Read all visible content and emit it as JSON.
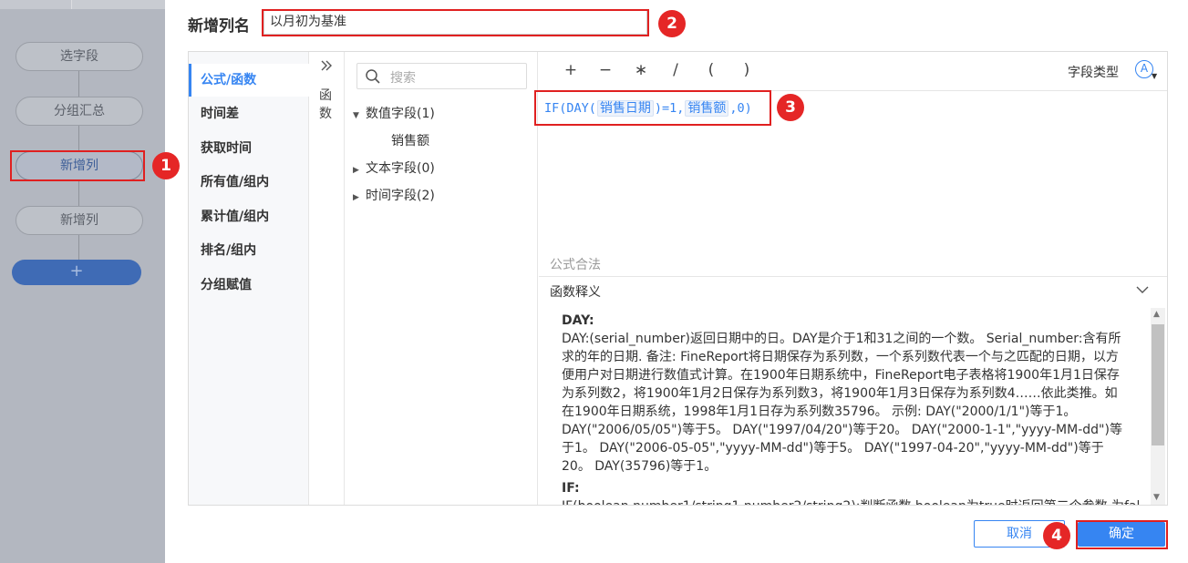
{
  "flow": {
    "nodes": [
      "选字段",
      "分组汇总",
      "新增列",
      "新增列"
    ],
    "add_label": "+"
  },
  "dialog": {
    "title_label": "新增列名",
    "column_name_value": "以月初为基准",
    "categories": [
      "公式/函数",
      "时间差",
      "获取时间",
      "所有值/组内",
      "累计值/组内",
      "排名/组内",
      "分组赋值"
    ],
    "collapse_label": "函数",
    "search_placeholder": "搜索",
    "tree": {
      "numeric_group": "数值字段(1)",
      "numeric_child": "销售额",
      "text_group": "文本字段(0)",
      "time_group": "时间字段(2)"
    },
    "operators": [
      "+",
      "−",
      "∗",
      "/",
      "(",
      ")"
    ],
    "field_type_label": "字段类型",
    "field_type_icon": "Ⓐ",
    "formula": {
      "p1": "IF(DAY(",
      "tok1": "销售日期",
      "p2": ")=1,",
      "tok2": "销售额",
      "p3": ",0)"
    },
    "valid_text": "公式合法",
    "explain_header": "函数释义",
    "explain": {
      "day_name": "DAY:",
      "day_desc": "DAY:(serial_number)返回日期中的日。DAY是介于1和31之间的一个数。 Serial_number:含有所求的年的日期. 备注: FineReport将日期保存为系列数，一个系列数代表一个与之匹配的日期，以方便用户对日期进行数值式计算。在1900年日期系统中，FineReport电子表格将1900年1月1日保存为系列数2，将1900年1月2日保存为系列数3，将1900年1月3日保存为系列数4……依此类推。如在1900年日期系统，1998年1月1日存为系列数35796。 示例: DAY(\"2000/1/1\")等于1。 DAY(\"2006/05/05\")等于5。 DAY(\"1997/04/20\")等于20。 DAY(\"2000-1-1\",\"yyyy-MM-dd\")等于1。 DAY(\"2006-05-05\",\"yyyy-MM-dd\")等于5。 DAY(\"1997-04-20\",\"yyyy-MM-dd\")等于20。 DAY(35796)等于1。",
      "if_name": "IF:",
      "if_desc": "IF(boolean,number1/string1,number2/string2):判断函数,boolean为true时返回第二个参数,为fal"
    },
    "cancel_label": "取消",
    "ok_label": "确定"
  },
  "badges": [
    "1",
    "2",
    "3",
    "4"
  ],
  "colors": {
    "accent": "#3685f2",
    "highlight_red": "#e02020",
    "flow_add_button": "#3f6bb5"
  }
}
